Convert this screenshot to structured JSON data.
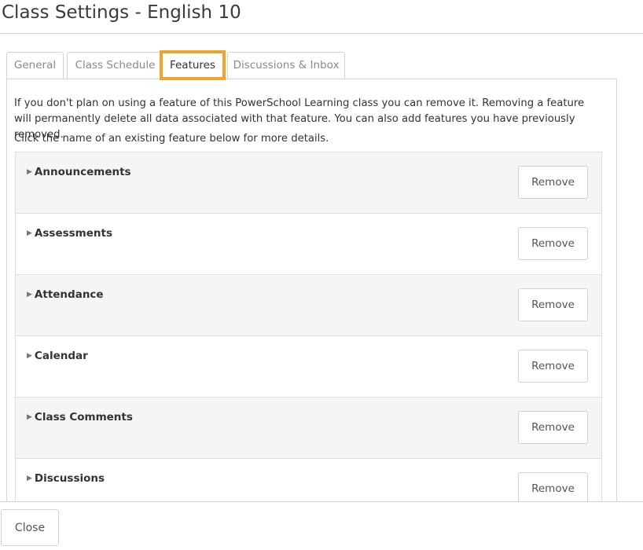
{
  "dialog": {
    "title": "Class Settings - English 10"
  },
  "tabs": [
    {
      "label": "General",
      "active": false
    },
    {
      "label": "Class Schedule",
      "active": false
    },
    {
      "label": "Features",
      "active": true
    },
    {
      "label": "Discussions & Inbox",
      "active": false
    }
  ],
  "colors": {
    "active_tab_highlight": "#f0a429",
    "row_alt_background": "#f5f5f5"
  },
  "features_panel": {
    "intro": "If you don't plan on using a feature of this PowerSchool Learning class you can remove it. Removing a feature will permanently delete all data associated with that feature. You can also add features you have previously removed.",
    "instruction": "Click the name of an existing feature below for more details.",
    "caret_icon": "triangle-right-icon",
    "items": [
      {
        "name": "Announcements",
        "action": "Remove"
      },
      {
        "name": "Assessments",
        "action": "Remove"
      },
      {
        "name": "Attendance",
        "action": "Remove"
      },
      {
        "name": "Calendar",
        "action": "Remove"
      },
      {
        "name": "Class Comments",
        "action": "Remove"
      },
      {
        "name": "Discussions",
        "action": "Remove"
      }
    ]
  },
  "footer": {
    "close_label": "Close"
  }
}
